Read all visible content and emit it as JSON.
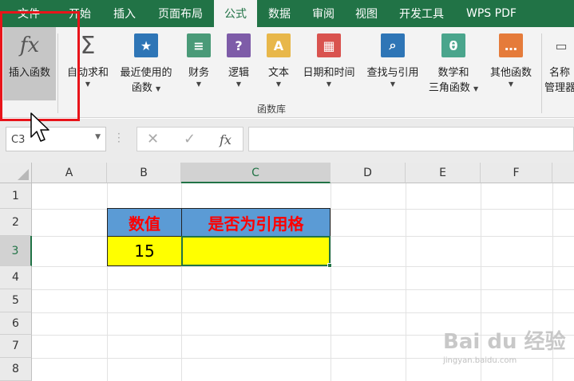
{
  "menu": {
    "tabs": [
      "文件",
      "开始",
      "插入",
      "页面布局",
      "公式",
      "数据",
      "审阅",
      "视图",
      "开发工具",
      "WPS PDF"
    ],
    "active": "公式"
  },
  "ribbon": {
    "insert_function": {
      "icon": "fx",
      "label": "插入函数"
    },
    "autosum": {
      "icon": "Σ",
      "label": "自动求和"
    },
    "recent": {
      "label1": "最近使用的",
      "label2": "函数"
    },
    "financial": {
      "label": "财务"
    },
    "logical": {
      "label": "逻辑"
    },
    "text": {
      "label": "文本"
    },
    "datetime": {
      "label": "日期和时间"
    },
    "lookup": {
      "label": "查找与引用"
    },
    "math": {
      "label1": "数学和",
      "label2": "三角函数"
    },
    "more": {
      "label": "其他函数"
    },
    "name_mgr": {
      "label1": "名称",
      "label2": "管理器"
    },
    "group_label": "函数库",
    "colors": {
      "logical": "#7e5ca8",
      "text": "#e8b74a",
      "datetime": "#d9534f",
      "lookup": "#2e75b6",
      "math": "#4aa58c",
      "more": "#e57b3a",
      "recent": "#2e75b6",
      "financial": "#4a9a78"
    }
  },
  "formula_bar": {
    "name_box": "C3",
    "fx_label": "fx",
    "value": ""
  },
  "sheet": {
    "columns": [
      "A",
      "B",
      "C",
      "D",
      "E",
      "F"
    ],
    "rows": [
      "1",
      "2",
      "3",
      "4",
      "5",
      "6",
      "7",
      "8"
    ],
    "selected_col": "C",
    "selected_row": "3",
    "b2": "数值",
    "c2": "是否为引用格",
    "b3": "15",
    "c3": ""
  },
  "watermark": {
    "brand": "Bai du 经验",
    "url": "jingyan.baidu.com"
  }
}
